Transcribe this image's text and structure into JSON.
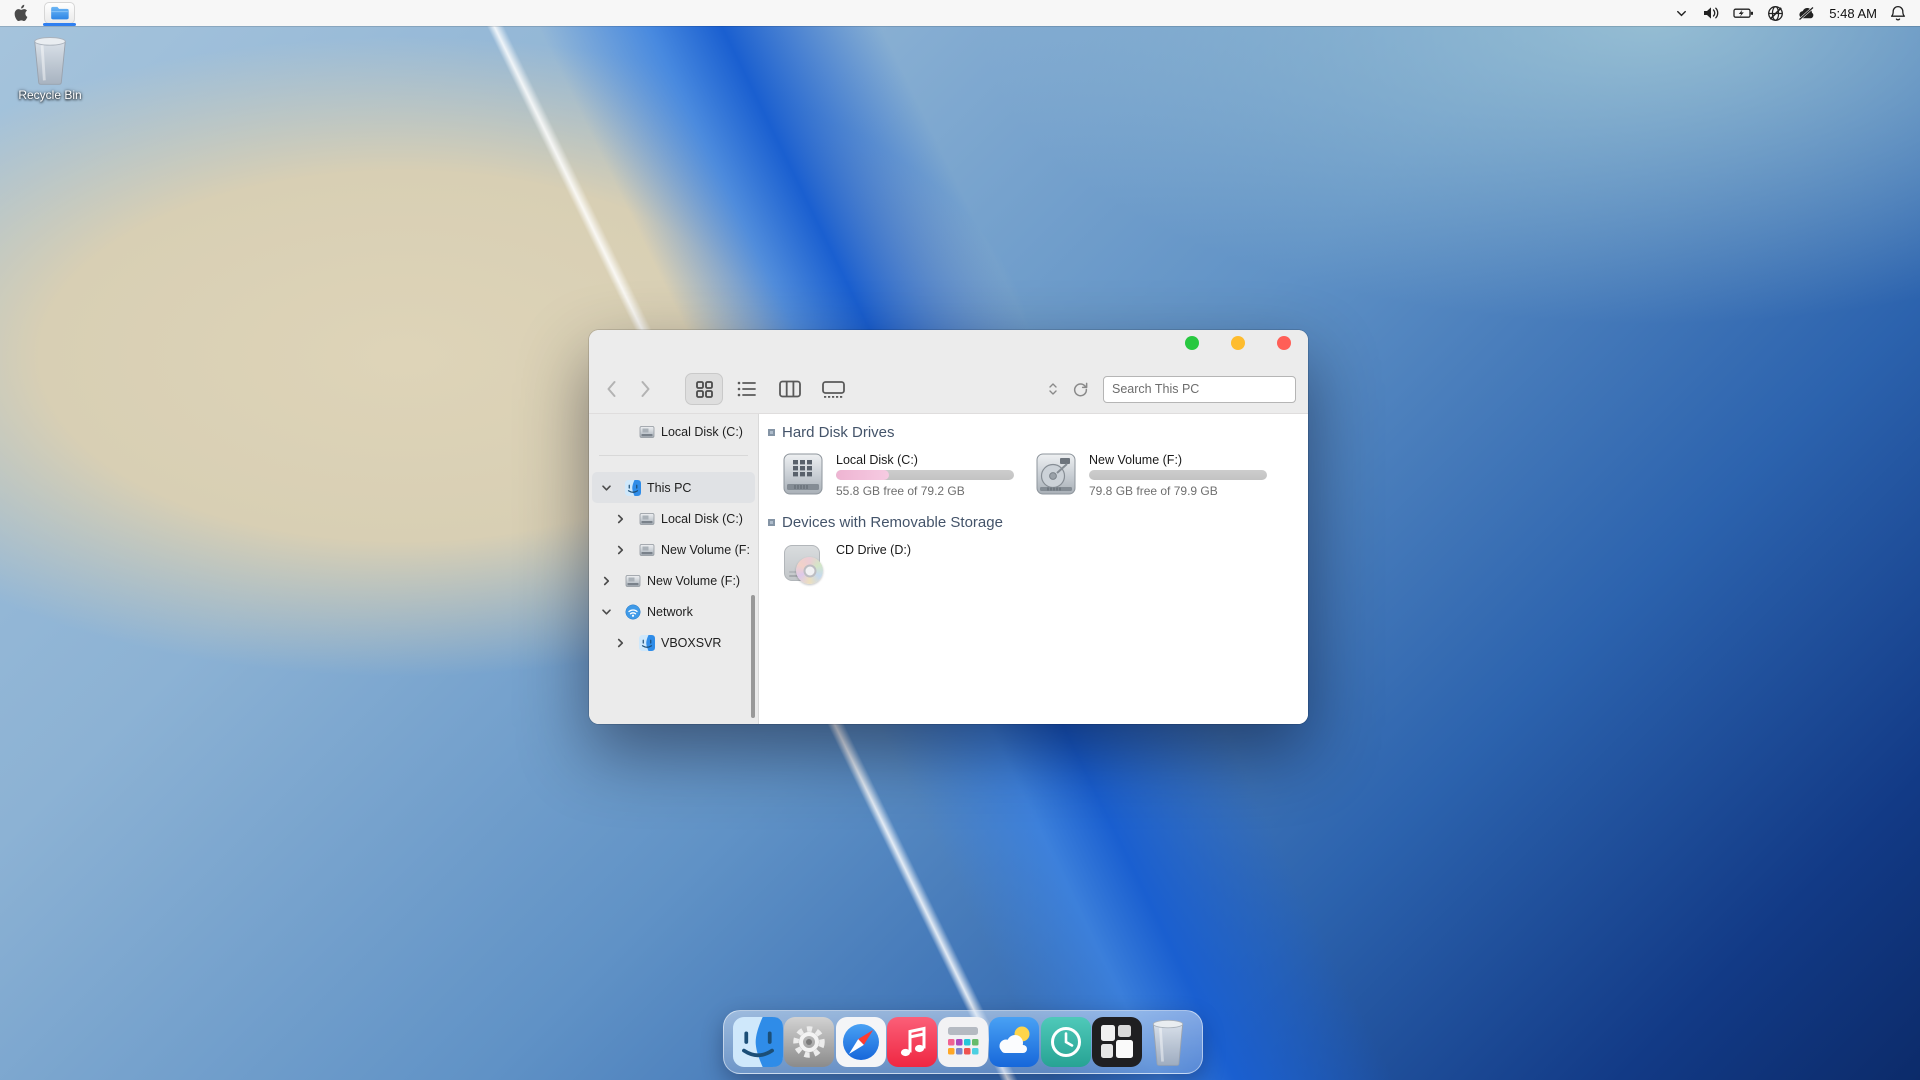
{
  "menubar": {
    "time": "5:48 AM",
    "tray_icons": [
      "chevron-down",
      "speaker",
      "battery-charging",
      "network-globe-offline",
      "cloud-offline",
      "bell"
    ]
  },
  "desktop": {
    "recycle_bin_label": "Recycle Bin"
  },
  "window": {
    "traffic_lights": [
      "maximize",
      "minimize",
      "close"
    ],
    "toolbar": {
      "search_placeholder": "Search This PC",
      "view_modes": [
        "grid",
        "list",
        "columns",
        "gallery"
      ],
      "active_view": "grid"
    },
    "sidebar": {
      "items": [
        {
          "label": "Local Disk (C:)",
          "icon": "hard-drive",
          "level": 1,
          "chevron": "none",
          "selected": false
        },
        {
          "label": "This PC",
          "icon": "finder-face",
          "level": 0,
          "chevron": "expanded",
          "selected": true
        },
        {
          "label": "Local Disk (C:)",
          "icon": "hard-drive",
          "level": 1,
          "chevron": "collapsed",
          "selected": false
        },
        {
          "label": "New Volume (F:",
          "icon": "hard-drive",
          "level": 1,
          "chevron": "collapsed",
          "selected": false
        },
        {
          "label": "New Volume (F:)",
          "icon": "hard-drive",
          "level": 0,
          "chevron": "collapsed",
          "selected": false
        },
        {
          "label": "Network",
          "icon": "network-globe",
          "level": 0,
          "chevron": "expanded",
          "selected": false
        },
        {
          "label": "VBOXSVR",
          "icon": "finder-face",
          "level": 1,
          "chevron": "collapsed",
          "selected": false
        }
      ]
    },
    "content": {
      "sections": [
        {
          "title": "Hard Disk Drives",
          "items": [
            {
              "name": "Local Disk (C:)",
              "caption": "55.8 GB free of 79.2 GB",
              "used_percent": 29.5,
              "icon": "hdd-grid"
            },
            {
              "name": "New Volume (F:)",
              "caption": "79.8 GB free of 79.9 GB",
              "used_percent": 0.2,
              "icon": "hdd-platter"
            }
          ]
        },
        {
          "title": "Devices with Removable Storage",
          "items": [
            {
              "name": "CD Drive (D:)",
              "icon": "cd-disc"
            }
          ]
        }
      ]
    }
  },
  "dock": {
    "items": [
      "finder",
      "system-preferences",
      "safari",
      "music",
      "launchpad",
      "weather",
      "time-machine",
      "app-grid",
      "trash"
    ]
  },
  "colors": {
    "accent": "#2f7ff0",
    "traffic_green": "#28c840",
    "traffic_yellow": "#febc2e",
    "traffic_red": "#ff5f57",
    "progress_pink": "#f6cbe2",
    "header_text": "#44546a"
  }
}
